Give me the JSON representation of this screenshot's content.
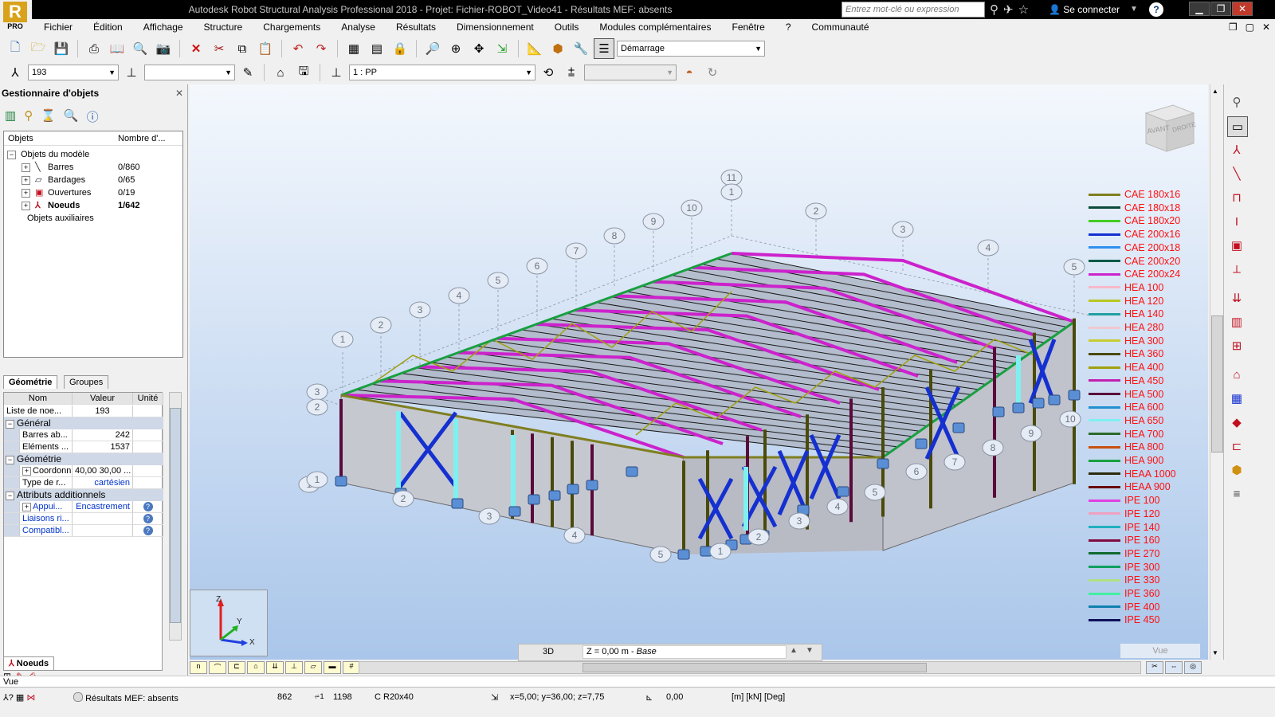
{
  "title_bar": {
    "title": "Autodesk Robot Structural Analysis Professional 2018 - Projet: Fichier-ROBOT_Video41 - Résultats MEF: absents",
    "search_placeholder": "Entrez mot-clé ou expression",
    "signin_label": "Se connecter",
    "help_label": "?",
    "logo_letter": "R",
    "logo_badge": "PRO"
  },
  "menu": [
    "Fichier",
    "Édition",
    "Affichage",
    "Structure",
    "Chargements",
    "Analyse",
    "Résultats",
    "Dimensionnement",
    "Outils",
    "Modules complémentaires",
    "Fenêtre",
    "?",
    "Communauté"
  ],
  "toolbar": {
    "layout_combo": "Démarrage",
    "selection_combo": "193",
    "load_case_combo": "1 : PP"
  },
  "object_inspector": {
    "title": "Gestionnaire d'objets",
    "col_objects": "Objets",
    "col_count": "Nombre d'...",
    "root": "Objets du modèle",
    "items": [
      {
        "label": "Barres",
        "count": "0/860"
      },
      {
        "label": "Bardages",
        "count": "0/65"
      },
      {
        "label": "Ouvertures",
        "count": "0/19"
      },
      {
        "label": "Noeuds",
        "count": "1/642"
      }
    ],
    "auxiliary": "Objets auxiliaires",
    "tabs": [
      "Géométrie",
      "Groupes"
    ],
    "bottom_tab": "Noeuds"
  },
  "properties": {
    "headers": [
      "Nom",
      "Valeur",
      "Unité"
    ],
    "node_list_label": "Liste de noe...",
    "node_list_value": "193",
    "section_general": "Général",
    "bars_label": "Barres ab...",
    "bars_value": "242",
    "elements_label": "Eléments ...",
    "elements_value": "1537",
    "section_geometry": "Géométrie",
    "coord_label": "Coordonn...",
    "coord_value": "40,00 30,00 ...",
    "type_label": "Type de r...",
    "type_value": "cartésien",
    "section_additional": "Attributs additionnels",
    "support_label": "Appui...",
    "support_value": "Encastrement",
    "links_label": "Liaisons ri...",
    "compat_label": "Compatibl..."
  },
  "viewcube": {
    "front": "AVANT",
    "right": "DROITE"
  },
  "axis_labels": {
    "z": "Z",
    "y": "Y",
    "x": "X"
  },
  "grid_labels_numbers": [
    "1",
    "2",
    "3",
    "4",
    "5",
    "6",
    "7",
    "8",
    "9",
    "10",
    "11"
  ],
  "legend": [
    {
      "name": "CAE 180x16",
      "color": "#7f7f20"
    },
    {
      "name": "CAE 180x18",
      "color": "#0c4a3a"
    },
    {
      "name": "CAE 180x20",
      "color": "#44cc22"
    },
    {
      "name": "CAE 200x16",
      "color": "#1530d0"
    },
    {
      "name": "CAE 200x18",
      "color": "#2f8ff0"
    },
    {
      "name": "CAE 200x20",
      "color": "#0a5a4a"
    },
    {
      "name": "CAE 200x24",
      "color": "#cc22cc"
    },
    {
      "name": "HEA 100",
      "color": "#f7b8c8"
    },
    {
      "name": "HEA 120",
      "color": "#b8c820"
    },
    {
      "name": "HEA 140",
      "color": "#20a0a0"
    },
    {
      "name": "HEA 280",
      "color": "#f0c8d0"
    },
    {
      "name": "HEA 300",
      "color": "#c8cc30"
    },
    {
      "name": "HEA 360",
      "color": "#4a4a0a"
    },
    {
      "name": "HEA 400",
      "color": "#a0a010"
    },
    {
      "name": "HEA 450",
      "color": "#c020b0"
    },
    {
      "name": "HEA 500",
      "color": "#5a0a3a"
    },
    {
      "name": "HEA 600",
      "color": "#2090d0"
    },
    {
      "name": "HEA 650",
      "color": "#7ff0f0"
    },
    {
      "name": "HEA 700",
      "color": "#2a6a2a"
    },
    {
      "name": "HEA 800",
      "color": "#c85010"
    },
    {
      "name": "HEA 900",
      "color": "#18a040"
    },
    {
      "name": "HEAA 1000",
      "color": "#2a2a0a"
    },
    {
      "name": "HEAA 900",
      "color": "#6a0a0a"
    },
    {
      "name": "IPE 100",
      "color": "#e040e0"
    },
    {
      "name": "IPE 120",
      "color": "#f0a0c0"
    },
    {
      "name": "IPE 140",
      "color": "#20b0c0"
    },
    {
      "name": "IPE 160",
      "color": "#800a40"
    },
    {
      "name": "IPE 270",
      "color": "#106a30"
    },
    {
      "name": "IPE 300",
      "color": "#10a060"
    },
    {
      "name": "IPE 330",
      "color": "#b0e080"
    },
    {
      "name": "IPE 360",
      "color": "#40f0a0"
    },
    {
      "name": "IPE 400",
      "color": "#1080b0"
    },
    {
      "name": "IPE 450",
      "color": "#10105a"
    }
  ],
  "view_bar": {
    "mode": "3D",
    "level": "Z = 0,00 m",
    "level_name": "Base",
    "view_hint": "Vue"
  },
  "view_label": "Vue",
  "status_bar": {
    "results": "Résultats MEF: absents",
    "count1": "862",
    "count2": "1198",
    "section": "C R20x40",
    "coords": "x=5,00; y=36,00; z=7,75",
    "value": "0,00",
    "units": "[m] [kN] [Deg]"
  }
}
